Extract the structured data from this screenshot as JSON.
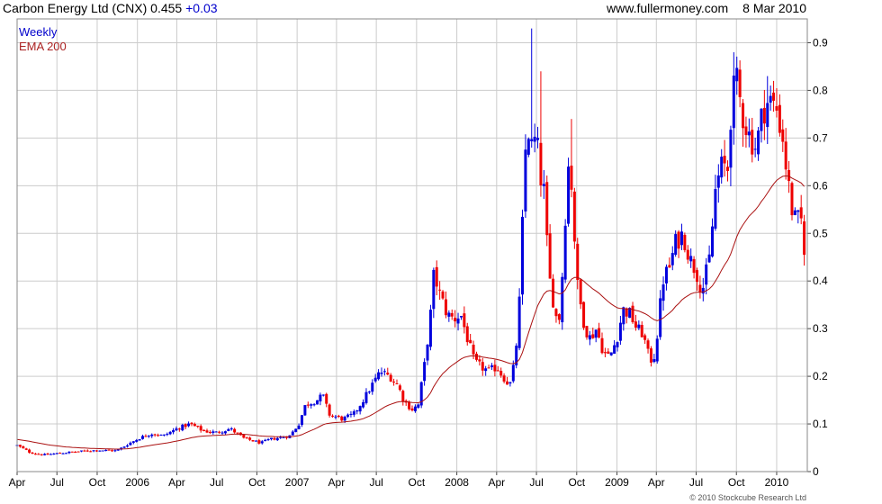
{
  "header": {
    "title": "Carbon Energy Ltd (CNX) 0.455",
    "change": "+0.03",
    "source": "www.fullermoney.com",
    "date": "8 Mar 2010"
  },
  "footer": {
    "copyright": "© 2010 Stockcube Research Ltd"
  },
  "colors": {
    "up": "#0000dd",
    "down": "#ee0000",
    "ema": "#aa1111",
    "grid": "#cccccc",
    "frame": "#888888"
  },
  "chart_data": {
    "type": "candlestick",
    "legend": [
      "Weekly",
      "EMA 200"
    ],
    "legend_position": "top-left",
    "grid": true,
    "y_axis_side": "right",
    "ylim": [
      0,
      0.95
    ],
    "y_ticks": [
      {
        "value": 0,
        "label": "0"
      },
      {
        "value": 0.1,
        "label": "0.1"
      },
      {
        "value": 0.2,
        "label": "0.2"
      },
      {
        "value": 0.3,
        "label": "0.3"
      },
      {
        "value": 0.4,
        "label": "0.4"
      },
      {
        "value": 0.5,
        "label": "0.5"
      },
      {
        "value": 0.6,
        "label": "0.6"
      },
      {
        "value": 0.7,
        "label": "0.7"
      },
      {
        "value": 0.8,
        "label": "0.8"
      },
      {
        "value": 0.9,
        "label": "0.9"
      }
    ],
    "x_range": [
      "2005-04-01",
      "2010-03-12"
    ],
    "x_ticks": [
      {
        "date": "2005-04-01",
        "label": "Apr"
      },
      {
        "date": "2005-07-01",
        "label": "Jul"
      },
      {
        "date": "2005-10-01",
        "label": "Oct"
      },
      {
        "date": "2006-01-01",
        "label": "2006"
      },
      {
        "date": "2006-04-01",
        "label": "Apr"
      },
      {
        "date": "2006-07-01",
        "label": "Jul"
      },
      {
        "date": "2006-10-01",
        "label": "Oct"
      },
      {
        "date": "2007-01-01",
        "label": "2007"
      },
      {
        "date": "2007-04-01",
        "label": "Apr"
      },
      {
        "date": "2007-07-01",
        "label": "Jul"
      },
      {
        "date": "2007-10-01",
        "label": "Oct"
      },
      {
        "date": "2008-01-01",
        "label": "2008"
      },
      {
        "date": "2008-04-01",
        "label": "Apr"
      },
      {
        "date": "2008-07-01",
        "label": "Jul"
      },
      {
        "date": "2008-10-01",
        "label": "Oct"
      },
      {
        "date": "2009-01-01",
        "label": "2009"
      },
      {
        "date": "2009-04-01",
        "label": "Apr"
      },
      {
        "date": "2009-07-01",
        "label": "Jul"
      },
      {
        "date": "2009-10-01",
        "label": "Oct"
      },
      {
        "date": "2010-01-01",
        "label": "2010"
      }
    ],
    "price_anchors": [
      [
        "2005-04-01",
        0.055
      ],
      [
        "2005-05-01",
        0.04
      ],
      [
        "2005-06-01",
        0.035
      ],
      [
        "2005-07-01",
        0.038
      ],
      [
        "2005-08-15",
        0.042
      ],
      [
        "2005-10-01",
        0.045
      ],
      [
        "2005-11-15",
        0.044
      ],
      [
        "2005-12-15",
        0.06
      ],
      [
        "2006-01-05",
        0.07
      ],
      [
        "2006-02-01",
        0.08
      ],
      [
        "2006-03-01",
        0.075
      ],
      [
        "2006-04-01",
        0.09
      ],
      [
        "2006-05-01",
        0.1
      ],
      [
        "2006-06-01",
        0.085
      ],
      [
        "2006-07-01",
        0.082
      ],
      [
        "2006-08-01",
        0.09
      ],
      [
        "2006-09-01",
        0.07
      ],
      [
        "2006-10-10",
        0.06
      ],
      [
        "2006-11-01",
        0.068
      ],
      [
        "2006-12-15",
        0.075
      ],
      [
        "2007-01-05",
        0.1
      ],
      [
        "2007-01-20",
        0.14
      ],
      [
        "2007-02-15",
        0.15
      ],
      [
        "2007-03-01",
        0.16
      ],
      [
        "2007-03-15",
        0.12
      ],
      [
        "2007-04-15",
        0.11
      ],
      [
        "2007-05-10",
        0.12
      ],
      [
        "2007-06-01",
        0.15
      ],
      [
        "2007-06-20",
        0.18
      ],
      [
        "2007-07-10",
        0.21
      ],
      [
        "2007-08-01",
        0.2
      ],
      [
        "2007-08-20",
        0.18
      ],
      [
        "2007-09-01",
        0.15
      ],
      [
        "2007-09-20",
        0.13
      ],
      [
        "2007-10-05",
        0.14
      ],
      [
        "2007-10-20",
        0.23
      ],
      [
        "2007-11-01",
        0.32
      ],
      [
        "2007-11-10",
        0.42
      ],
      [
        "2007-11-20",
        0.38
      ],
      [
        "2007-12-10",
        0.33
      ],
      [
        "2007-12-25",
        0.32
      ],
      [
        "2008-01-10",
        0.33
      ],
      [
        "2008-01-25",
        0.28
      ],
      [
        "2008-02-10",
        0.23
      ],
      [
        "2008-02-25",
        0.22
      ],
      [
        "2008-03-15",
        0.21
      ],
      [
        "2008-04-01",
        0.22
      ],
      [
        "2008-04-15",
        0.2
      ],
      [
        "2008-05-01",
        0.18
      ],
      [
        "2008-05-10",
        0.22
      ],
      [
        "2008-05-20",
        0.3
      ],
      [
        "2008-05-28",
        0.45
      ],
      [
        "2008-06-03",
        0.65
      ],
      [
        "2008-06-12",
        0.72
      ],
      [
        "2008-06-20",
        0.68
      ],
      [
        "2008-07-01",
        0.7
      ],
      [
        "2008-07-10",
        0.62
      ],
      [
        "2008-07-20",
        0.58
      ],
      [
        "2008-07-28",
        0.42
      ],
      [
        "2008-08-10",
        0.35
      ],
      [
        "2008-08-20",
        0.3
      ],
      [
        "2008-09-01",
        0.45
      ],
      [
        "2008-09-10",
        0.65
      ],
      [
        "2008-09-20",
        0.6
      ],
      [
        "2008-10-01",
        0.4
      ],
      [
        "2008-10-10",
        0.35
      ],
      [
        "2008-10-20",
        0.3
      ],
      [
        "2008-11-01",
        0.28
      ],
      [
        "2008-11-15",
        0.3
      ],
      [
        "2008-12-01",
        0.25
      ],
      [
        "2008-12-15",
        0.24
      ],
      [
        "2009-01-01",
        0.28
      ],
      [
        "2009-01-15",
        0.34
      ],
      [
        "2009-02-01",
        0.33
      ],
      [
        "2009-02-15",
        0.3
      ],
      [
        "2009-03-01",
        0.29
      ],
      [
        "2009-03-15",
        0.24
      ],
      [
        "2009-03-25",
        0.23
      ],
      [
        "2009-04-05",
        0.3
      ],
      [
        "2009-04-15",
        0.4
      ],
      [
        "2009-05-01",
        0.43
      ],
      [
        "2009-05-15",
        0.48
      ],
      [
        "2009-06-01",
        0.5
      ],
      [
        "2009-06-15",
        0.45
      ],
      [
        "2009-07-01",
        0.42
      ],
      [
        "2009-07-15",
        0.38
      ],
      [
        "2009-08-01",
        0.45
      ],
      [
        "2009-08-15",
        0.6
      ],
      [
        "2009-09-01",
        0.65
      ],
      [
        "2009-09-10",
        0.62
      ],
      [
        "2009-09-20",
        0.78
      ],
      [
        "2009-10-01",
        0.82
      ],
      [
        "2009-10-15",
        0.75
      ],
      [
        "2009-11-01",
        0.7
      ],
      [
        "2009-11-15",
        0.68
      ],
      [
        "2009-12-01",
        0.76
      ],
      [
        "2009-12-15",
        0.78
      ],
      [
        "2010-01-01",
        0.76
      ],
      [
        "2010-01-15",
        0.7
      ],
      [
        "2010-01-25",
        0.62
      ],
      [
        "2010-02-05",
        0.55
      ],
      [
        "2010-02-15",
        0.52
      ],
      [
        "2010-02-25",
        0.54
      ],
      [
        "2010-03-01",
        0.48
      ],
      [
        "2010-03-08",
        0.455
      ]
    ],
    "spikes": [
      {
        "date": "2008-06-20",
        "high": 0.93
      },
      {
        "date": "2008-07-08",
        "high": 0.84
      },
      {
        "date": "2008-09-18",
        "high": 0.74
      },
      {
        "date": "2009-09-24",
        "high": 0.88
      },
      {
        "date": "2009-12-10",
        "high": 0.83
      }
    ]
  }
}
